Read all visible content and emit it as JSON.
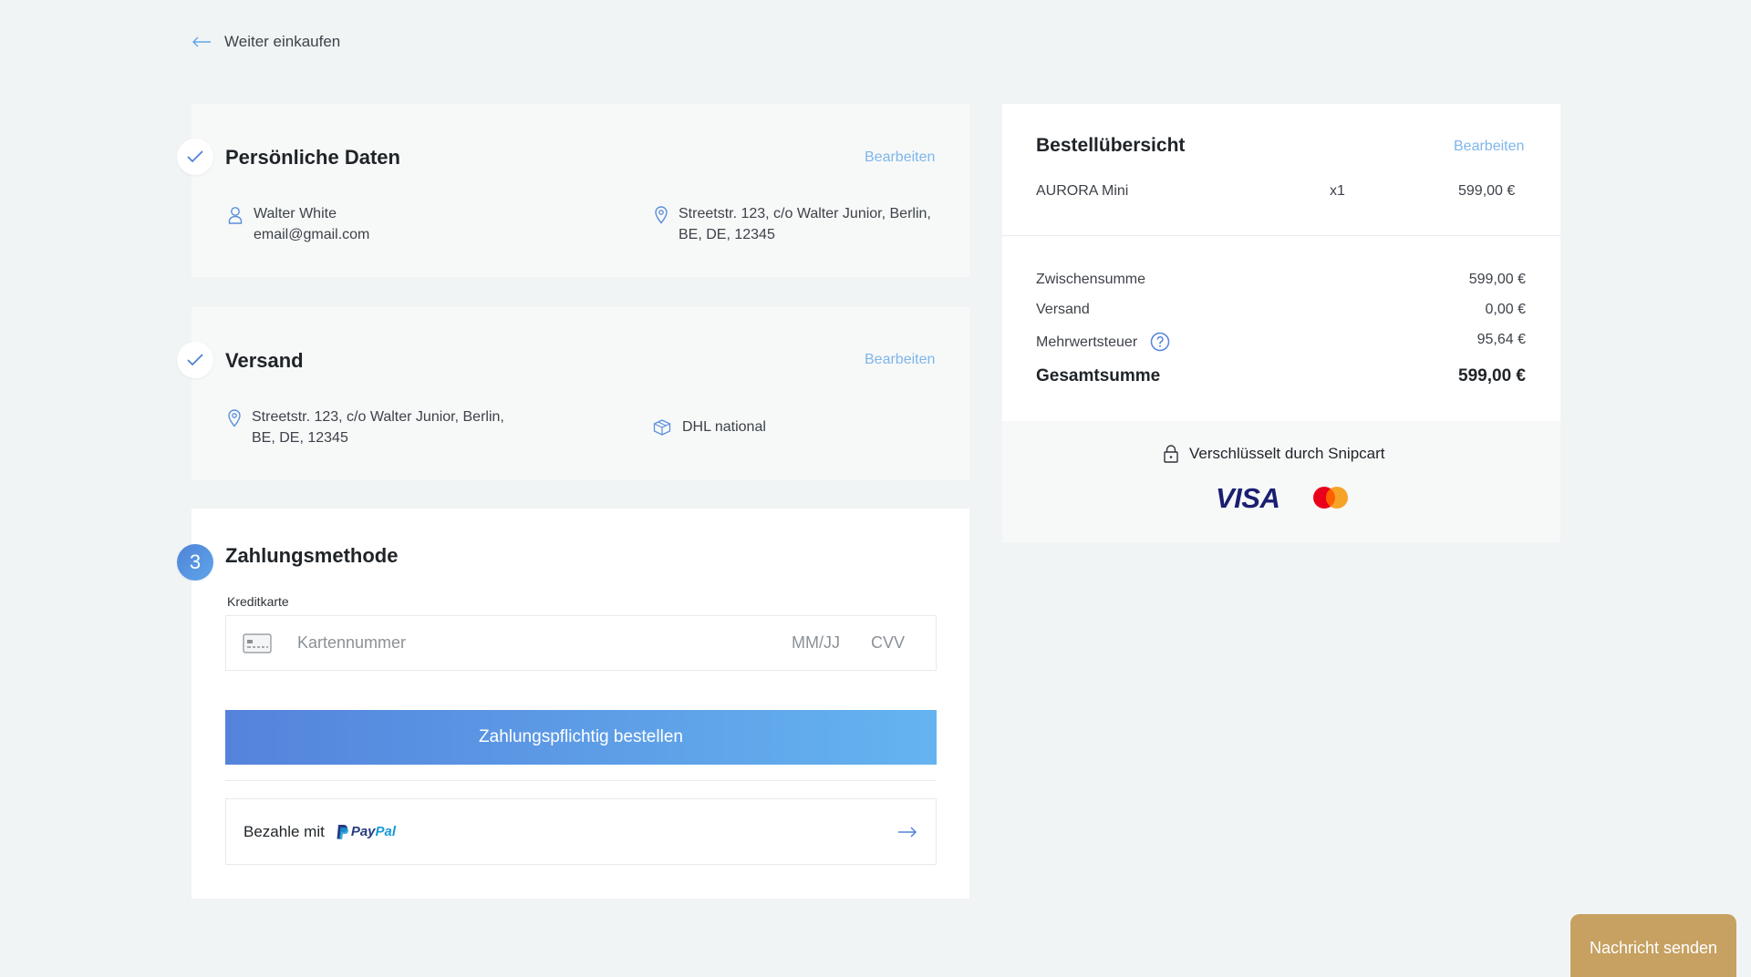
{
  "nav": {
    "back_label": "Weiter einkaufen"
  },
  "personal": {
    "title": "Persönliche Daten",
    "edit_label": "Bearbeiten",
    "name": "Walter White",
    "email": "email@gmail.com",
    "address_line1": "Streetstr. 123, c/o Walter Junior, Berlin,",
    "address_line2": "BE, DE, 12345"
  },
  "shipping": {
    "title": "Versand",
    "edit_label": "Bearbeiten",
    "address_line1": "Streetstr. 123, c/o Walter Junior, Berlin,",
    "address_line2": "BE, DE, 12345",
    "method": "DHL national"
  },
  "payment": {
    "step_number": "3",
    "title": "Zahlungsmethode",
    "card_label": "Kreditkarte",
    "card_number_placeholder": "Kartennummer",
    "expiry_placeholder": "MM/JJ",
    "cvv_placeholder": "CVV",
    "submit_label": "Zahlungspflichtig bestellen",
    "paypal_prefix": "Bezahle mit",
    "paypal_brand_1": "Pay",
    "paypal_brand_2": "Pal"
  },
  "summary": {
    "title": "Bestellübersicht",
    "edit_label": "Bearbeiten",
    "item_name": "AURORA Mini",
    "item_qty": "x1",
    "item_price": "599,00 €",
    "subtotal_label": "Zwischensumme",
    "subtotal_value": "599,00 €",
    "shipping_label": "Versand",
    "shipping_value": "0,00 €",
    "vat_label": "Mehrwertsteuer",
    "vat_value": "95,64 €",
    "total_label": "Gesamtsumme",
    "total_value": "599,00 €",
    "secure_label": "Verschlüsselt durch Snipcart",
    "visa_label": "VISA"
  },
  "chat": {
    "label": "Nachricht senden"
  },
  "colors": {
    "accent": "#5fa6ea",
    "edit_link": "#7fb5ea",
    "chat": "#c6a161",
    "background": "#f1f4f5"
  }
}
